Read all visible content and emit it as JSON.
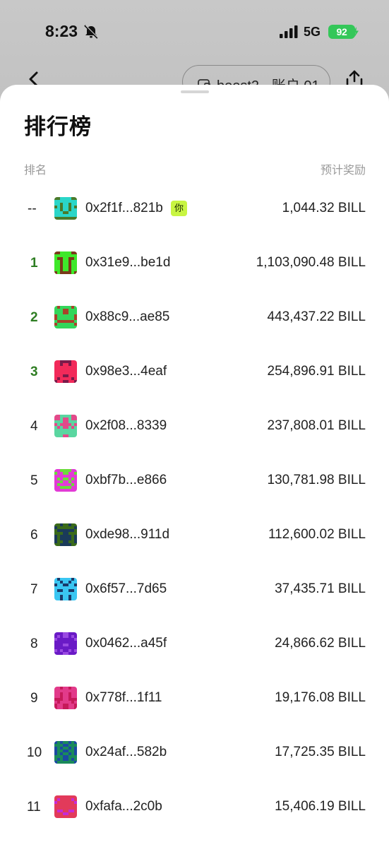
{
  "status_bar": {
    "time": "8:23",
    "network": "5G",
    "battery": "92"
  },
  "nav": {
    "account_label": "boost2 - 账户 01"
  },
  "sheet": {
    "title": "排行榜",
    "col_rank": "排名",
    "col_reward": "预计奖励"
  },
  "leaderboard": [
    {
      "rank": "--",
      "address": "0x2f1f...821b",
      "badge": "你",
      "reward": "1,044.32 BILL",
      "avatar_colors": [
        "#2ad6c8",
        "#4a7a2a"
      ]
    },
    {
      "rank": "1",
      "address": "0x31e9...be1d",
      "reward": "1,103,090.48 BILL",
      "avatar_colors": [
        "#3ee82a",
        "#7a3a1a"
      ]
    },
    {
      "rank": "2",
      "address": "0x88c9...ae85",
      "reward": "443,437.22 BILL",
      "avatar_colors": [
        "#33d65a",
        "#a8422a"
      ]
    },
    {
      "rank": "3",
      "address": "0x98e3...4eaf",
      "reward": "254,896.91 BILL",
      "avatar_colors": [
        "#f22a5a",
        "#7a1a4a"
      ]
    },
    {
      "rank": "4",
      "address": "0x2f08...8339",
      "reward": "237,808.01 BILL",
      "avatar_colors": [
        "#5ad6a0",
        "#e24a8a"
      ]
    },
    {
      "rank": "5",
      "address": "0xbf7b...e866",
      "reward": "130,781.98 BILL",
      "avatar_colors": [
        "#e23ad6",
        "#6adc3a"
      ]
    },
    {
      "rank": "6",
      "address": "0xde98...911d",
      "reward": "112,600.02 BILL",
      "avatar_colors": [
        "#3a6a1a",
        "#1a3a5a"
      ]
    },
    {
      "rank": "7",
      "address": "0x6f57...7d65",
      "reward": "37,435.71 BILL",
      "avatar_colors": [
        "#3ac6f2",
        "#1a3a6a"
      ]
    },
    {
      "rank": "8",
      "address": "0x0462...a45f",
      "reward": "24,866.62 BILL",
      "avatar_colors": [
        "#6a1ac6",
        "#9a4ae2"
      ]
    },
    {
      "rank": "9",
      "address": "0x778f...1f11",
      "reward": "19,176.08 BILL",
      "avatar_colors": [
        "#e23a8a",
        "#c61a5a"
      ]
    },
    {
      "rank": "10",
      "address": "0x24af...582b",
      "reward": "17,725.35 BILL",
      "avatar_colors": [
        "#1a8a5a",
        "#1a4aa2"
      ]
    },
    {
      "rank": "11",
      "address": "0xfafa...2c0b",
      "reward": "15,406.19 BILL",
      "avatar_colors": [
        "#e23a5a",
        "#c62ad6"
      ]
    }
  ]
}
